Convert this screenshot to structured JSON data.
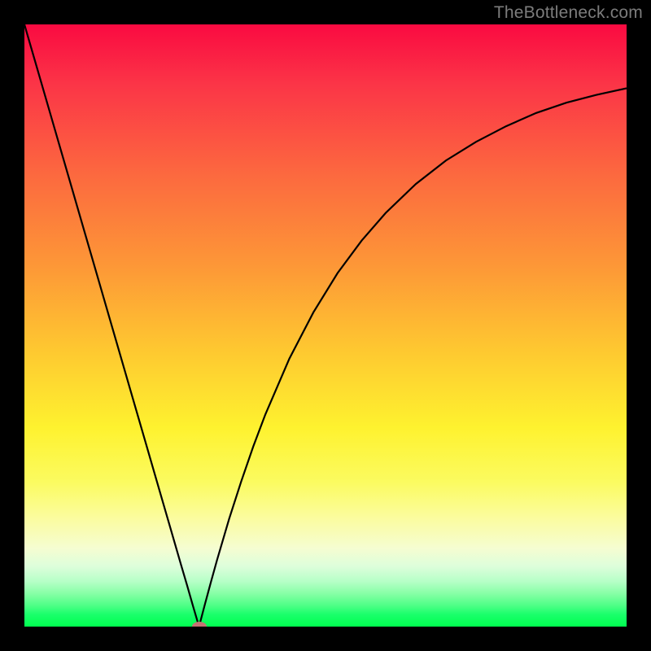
{
  "watermark": "TheBottleneck.com",
  "chart_data": {
    "type": "line",
    "title": "",
    "xlabel": "",
    "ylabel": "",
    "xlim": [
      0,
      100
    ],
    "ylim": [
      0,
      100
    ],
    "grid": false,
    "background": "rainbow-gradient-vertical",
    "marker": {
      "x": 29,
      "y": 0,
      "color": "#c47373"
    },
    "series": [
      {
        "name": "bottleneck-curve",
        "color": "#000000",
        "x": [
          0,
          2,
          4,
          6,
          8,
          10,
          12,
          14,
          16,
          18,
          20,
          22,
          24,
          26,
          27,
          28,
          29,
          30,
          31,
          32,
          34,
          36,
          38,
          40,
          44,
          48,
          52,
          56,
          60,
          65,
          70,
          75,
          80,
          85,
          90,
          95,
          100
        ],
        "y": [
          100,
          93.1,
          86.2,
          79.3,
          72.4,
          65.5,
          58.6,
          51.7,
          44.8,
          37.9,
          31.0,
          24.1,
          17.2,
          10.3,
          6.9,
          3.4,
          0.0,
          3.8,
          7.5,
          11.1,
          17.9,
          24.1,
          29.9,
          35.2,
          44.5,
          52.2,
          58.7,
          64.1,
          68.7,
          73.5,
          77.4,
          80.5,
          83.1,
          85.3,
          87.0,
          88.3,
          89.4
        ]
      }
    ]
  },
  "colors": {
    "gradient_top": "#fa0a41",
    "gradient_bottom": "#00ff4f",
    "curve": "#000000",
    "frame": "#000000",
    "marker": "#c47373",
    "watermark": "#7c7c7c"
  }
}
